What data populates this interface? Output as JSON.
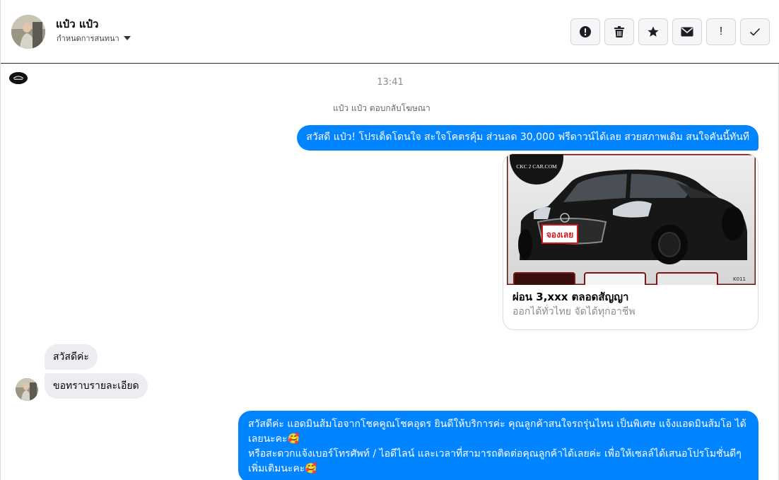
{
  "header": {
    "contact_name": "แป๋ว แป๋ว",
    "assign_label": "กำหนดการสนทนา"
  },
  "actions": [
    {
      "icon": "alert-circle-icon"
    },
    {
      "icon": "trash-icon"
    },
    {
      "icon": "star-icon"
    },
    {
      "icon": "envelope-icon"
    },
    {
      "icon": "exclamation-icon",
      "label": "!"
    },
    {
      "icon": "check-icon"
    }
  ],
  "chat": {
    "timestamp": "13:41",
    "reply_note": "แป๋ว แป๋ว ตอบกลับโฆษณา",
    "ad_message": "สวัสดี แป๋ว! โปรเด็ดโดนใจ สะใจโคตรคุ้ม ส่วนลด 30,000 ฟรีดาวน์ได้เลย สวยสภาพเดิม สนใจคันนี้ทันที",
    "ad_card": {
      "brand_text": "CKC 2 CAR.COM",
      "badge_text": "จองเลย",
      "code_text": "K011",
      "title": "ผ่อน 3,xxx ตลอดสัญญา",
      "subtitle": "ออกได้ทั่วไทย จัดได้ทุกอาชีพ"
    },
    "incoming": [
      "สวัสดีค่ะ",
      "ขอทราบรายละเอียด"
    ],
    "outgoing_reply": [
      "สวัสดีค่ะ แอดมินส้มโอจากโชคคูณโชคอุดร ยินดีให้บริการค่ะ   คุณลูกค้าสนใจรถรุ่นไหน เป็นพิเศษ แจ้งแอดมินส้มโอ ได้เลยนะคะ🥰",
      "หรือสะดวกแจ้งเบอร์โทรศัพท์ / ไอดีไลน์ และเวลาที่สามารถติดต่อคุณลูกค้าได้เลยค่ะ เพื่อให้เซลล์ได้เสนอโปรโมชั่นดีๆเพิ่มเติมนะคะ🥰"
    ]
  },
  "colors": {
    "outgoing_bubble": "#0084ff",
    "incoming_bubble": "#ebedf0",
    "muted_text": "#8a8d91"
  }
}
